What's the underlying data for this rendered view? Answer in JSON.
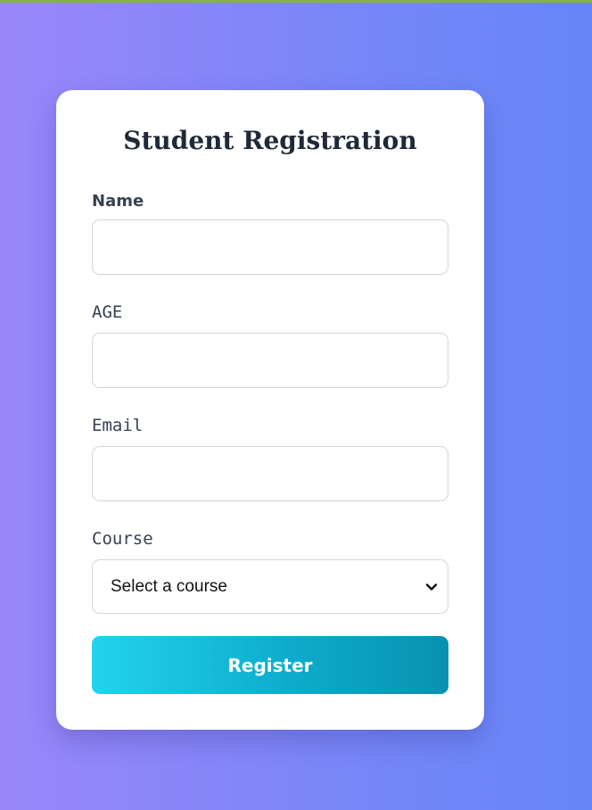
{
  "form": {
    "title": "Student Registration",
    "fields": {
      "name": {
        "label": "Name",
        "value": "",
        "placeholder": ""
      },
      "age": {
        "label": "AGE",
        "value": "",
        "placeholder": ""
      },
      "email": {
        "label": "Email",
        "value": "",
        "placeholder": ""
      },
      "course": {
        "label": "Course",
        "selected": "Select a course"
      }
    },
    "submit_label": "Register"
  },
  "icons": {
    "course_dropdown": "chevron-down-icon"
  },
  "colors": {
    "background_start": "#9a86fb",
    "background_end": "#6586f7",
    "button_start": "#22d3ee",
    "button_end": "#0891b2",
    "title_text": "#1f2937"
  }
}
